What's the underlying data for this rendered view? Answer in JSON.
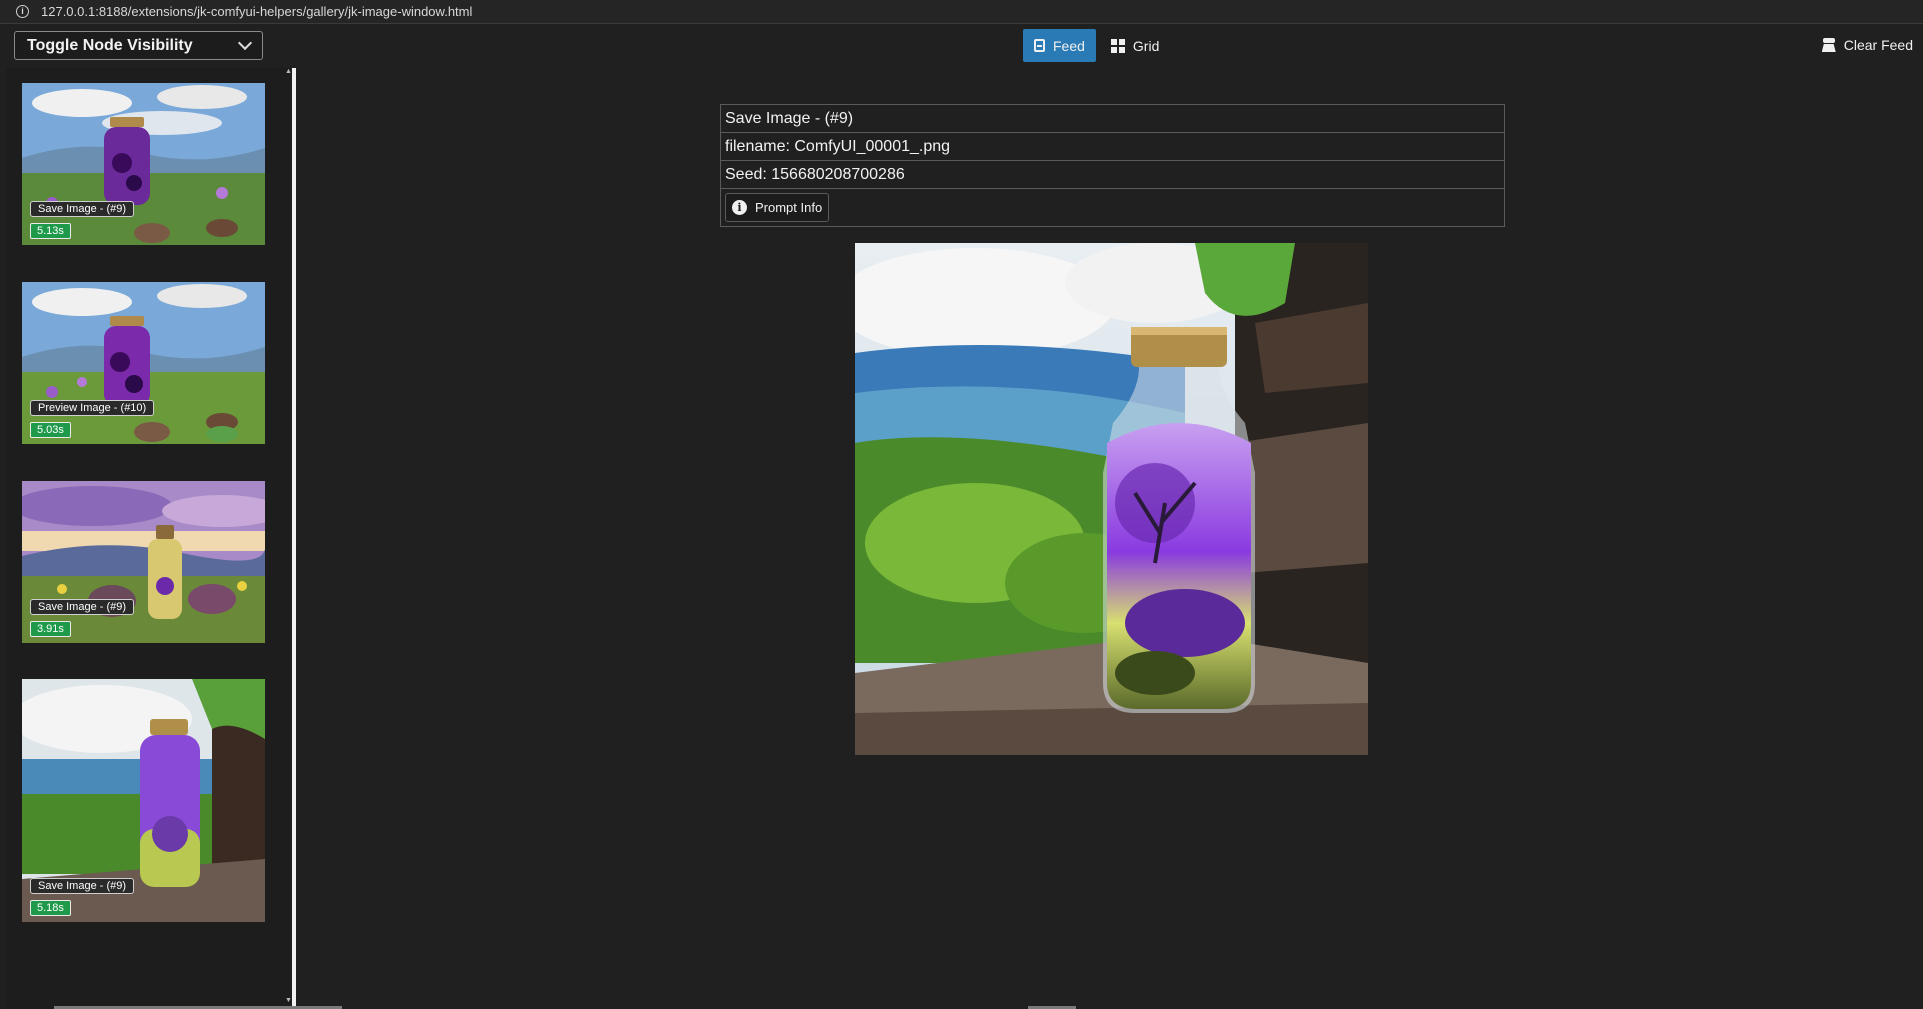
{
  "browser": {
    "url": "127.0.0.1:8188/extensions/jk-comfyui-helpers/gallery/jk-image-window.html"
  },
  "toolbar": {
    "toggle_label": "Toggle Node Visibility",
    "feed_label": "Feed",
    "grid_label": "Grid",
    "clear_label": "Clear Feed",
    "active_view": "Feed"
  },
  "thumbnails": [
    {
      "label": "Save Image - (#9)",
      "time": "5.13s",
      "scene": "meadow"
    },
    {
      "label": "Preview Image - (#10)",
      "time": "5.03s",
      "scene": "meadow"
    },
    {
      "label": "Save Image - (#9)",
      "time": "3.91s",
      "scene": "sunset"
    },
    {
      "label": "Save Image - (#9)",
      "time": "5.18s",
      "scene": "table"
    }
  ],
  "details": {
    "title": "Save Image - (#9)",
    "filename": "filename: ComfyUI_00001_.png",
    "seed": "Seed: 156680208700286",
    "prompt_button": "Prompt Info"
  },
  "colors": {
    "accent": "#2a7ab5",
    "time_badge": "#1e9a4a",
    "background": "#202020"
  },
  "icons": [
    "info-icon",
    "chevron-down-icon",
    "feed-icon",
    "grid-icon",
    "broom-icon"
  ]
}
